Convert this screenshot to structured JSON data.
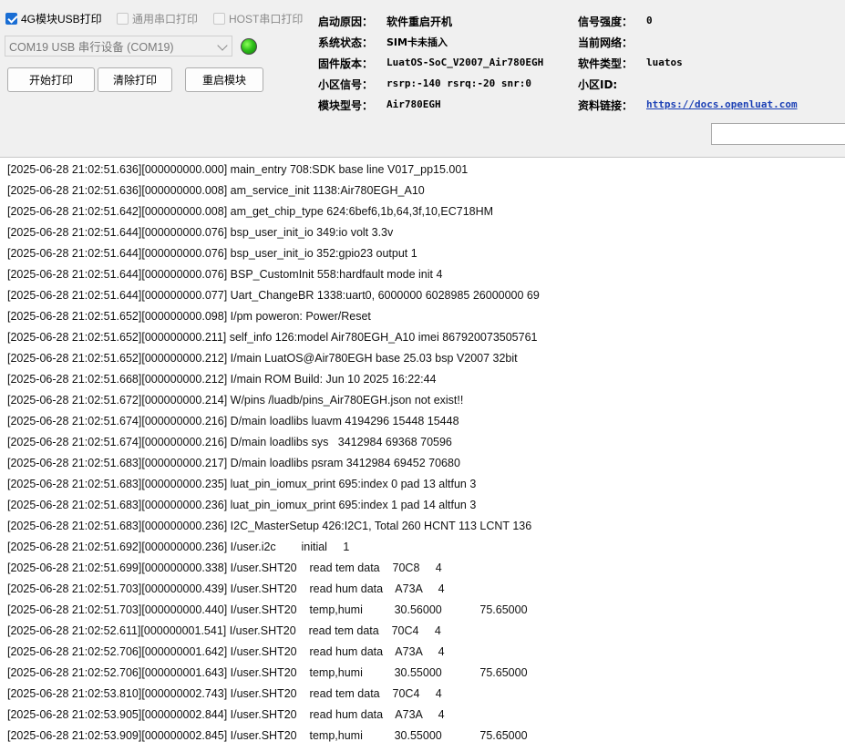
{
  "controls": {
    "chk_4g_label": "4G模块USB打印",
    "chk_4g_checked": true,
    "chk_uart_label": "通用串口打印",
    "chk_uart_checked": false,
    "chk_host_label": "HOST串口打印",
    "chk_host_checked": false,
    "port_select": "COM19 USB 串行设备 (COM19)",
    "status_led_color": "#2fc11a",
    "btn_start": "开始打印",
    "btn_clear": "清除打印",
    "btn_restart": "重启模块"
  },
  "info": {
    "boot_reason_label": "启动原因：",
    "boot_reason_value": "软件重启开机",
    "sys_status_label": "系统状态：",
    "sys_status_value": "SIM卡未插入",
    "firmware_label": "固件版本：",
    "firmware_value": "LuatOS-SoC_V2007_Air780EGH",
    "cell_signal_label": "小区信号：",
    "cell_signal_value": "rsrp:-140 rsrq:-20 snr:0",
    "module_model_label": "模块型号：",
    "module_model_value": "Air780EGH",
    "signal_strength_label": "信号强度：",
    "signal_strength_value": "0",
    "network_label": "当前网络：",
    "network_value": "",
    "software_type_label": "软件类型：",
    "software_type_value": "luatos",
    "cell_id_label": "小区ID:",
    "cell_id_value": "",
    "doc_link_label": "资料链接：",
    "doc_link_value": "https://docs.openluat.com"
  },
  "search": {
    "value": ""
  },
  "log_lines": [
    "[2025-06-28 21:02:51.636][000000000.000] main_entry 708:SDK base line V017_pp15.001",
    "[2025-06-28 21:02:51.636][000000000.008] am_service_init 1138:Air780EGH_A10",
    "[2025-06-28 21:02:51.642][000000000.008] am_get_chip_type 624:6bef6,1b,64,3f,10,EC718HM",
    "[2025-06-28 21:02:51.644][000000000.076] bsp_user_init_io 349:io volt 3.3v",
    "[2025-06-28 21:02:51.644][000000000.076] bsp_user_init_io 352:gpio23 output 1",
    "[2025-06-28 21:02:51.644][000000000.076] BSP_CustomInit 558:hardfault mode init 4",
    "[2025-06-28 21:02:51.644][000000000.077] Uart_ChangeBR 1338:uart0, 6000000 6028985 26000000 69",
    "[2025-06-28 21:02:51.652][000000000.098] I/pm poweron: Power/Reset",
    "[2025-06-28 21:02:51.652][000000000.211] self_info 126:model Air780EGH_A10 imei 867920073505761",
    "[2025-06-28 21:02:51.652][000000000.212] I/main LuatOS@Air780EGH base 25.03 bsp V2007 32bit",
    "[2025-06-28 21:02:51.668][000000000.212] I/main ROM Build: Jun 10 2025 16:22:44",
    "[2025-06-28 21:02:51.672][000000000.214] W/pins /luadb/pins_Air780EGH.json not exist!!",
    "[2025-06-28 21:02:51.674][000000000.216] D/main loadlibs luavm 4194296 15448 15448",
    "[2025-06-28 21:02:51.674][000000000.216] D/main loadlibs sys   3412984 69368 70596",
    "[2025-06-28 21:02:51.683][000000000.217] D/main loadlibs psram 3412984 69452 70680",
    "[2025-06-28 21:02:51.683][000000000.235] luat_pin_iomux_print 695:index 0 pad 13 altfun 3",
    "[2025-06-28 21:02:51.683][000000000.236] luat_pin_iomux_print 695:index 1 pad 14 altfun 3",
    "[2025-06-28 21:02:51.683][000000000.236] I2C_MasterSetup 426:I2C1, Total 260 HCNT 113 LCNT 136",
    "[2025-06-28 21:02:51.692][000000000.236] I/user.i2c        initial     1",
    "[2025-06-28 21:02:51.699][000000000.338] I/user.SHT20    read tem data    70C8     4",
    "[2025-06-28 21:02:51.703][000000000.439] I/user.SHT20    read hum data    A73A     4",
    "[2025-06-28 21:02:51.703][000000000.440] I/user.SHT20    temp,humi          30.56000            75.65000",
    "[2025-06-28 21:02:52.611][000000001.541] I/user.SHT20    read tem data    70C4     4",
    "[2025-06-28 21:02:52.706][000000001.642] I/user.SHT20    read hum data    A73A     4",
    "[2025-06-28 21:02:52.706][000000001.643] I/user.SHT20    temp,humi          30.55000            75.65000",
    "[2025-06-28 21:02:53.810][000000002.743] I/user.SHT20    read tem data    70C4     4",
    "[2025-06-28 21:02:53.905][000000002.844] I/user.SHT20    read hum data    A73A     4",
    "[2025-06-28 21:02:53.909][000000002.845] I/user.SHT20    temp,humi          30.55000            75.65000"
  ]
}
